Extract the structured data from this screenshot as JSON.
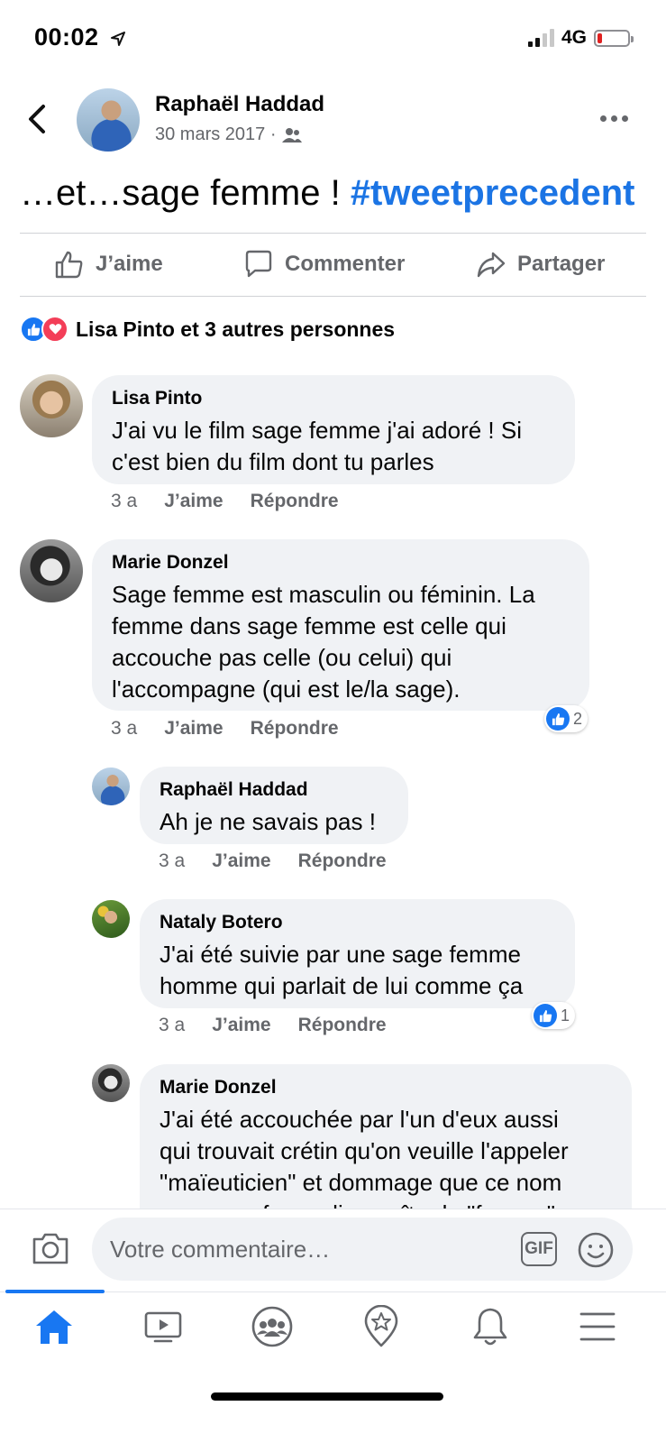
{
  "status_bar": {
    "time": "00:02",
    "network": "4G"
  },
  "post": {
    "author": "Raphaël Haddad",
    "date": "30 mars 2017 ·",
    "text": "…et…sage femme !",
    "hashtag": "#tweetprecedent"
  },
  "actions": {
    "like": "J’aime",
    "comment": "Commenter",
    "share": "Partager"
  },
  "reactions": {
    "summary": "Lisa Pinto et 3 autres personnes"
  },
  "comments": [
    {
      "name": "Lisa Pinto",
      "text_lines": [
        "J'ai vu le film sage femme j'ai adoré ! Si",
        "c'est bien du film dont tu parles"
      ],
      "age": "3 a",
      "like": "J’aime",
      "reply": "Répondre"
    },
    {
      "name": "Marie Donzel",
      "text_lines": [
        "Sage femme est masculin ou féminin. La",
        "femme dans sage femme est celle qui",
        "accouche pas celle (ou celui) qui",
        "l'accompagne (qui est le/la sage)."
      ],
      "age": "3 a",
      "like": "J’aime",
      "reply": "Répondre",
      "reaction_count": "2"
    },
    {
      "name": "Raphaël Haddad",
      "text_lines": [
        "Ah je ne savais pas !"
      ],
      "age": "3 a",
      "like": "J’aime",
      "reply": "Répondre"
    },
    {
      "name": "Nataly Botero",
      "text_lines": [
        "J'ai été suivie par une sage femme",
        "homme qui parlait de lui comme ça"
      ],
      "age": "3 a",
      "like": "J’aime",
      "reply": "Répondre",
      "reaction_count": "1"
    },
    {
      "name": "Marie Donzel",
      "text_lines": [
        "J'ai été accouchée par l'un d'eux aussi",
        "qui trouvait crétin qu'on veuille l'appeler",
        "\"maïeuticien\" et dommage que ce nom",
        "pompeux fasse disparaître le \"femme\""
      ]
    }
  ],
  "composer": {
    "placeholder": "Votre commentaire…",
    "gif": "GIF"
  },
  "nav": [
    "home-icon",
    "video-icon",
    "groups-icon",
    "pages-icon",
    "bell-icon",
    "menu-icon"
  ],
  "colors": {
    "accent": "#1877f2",
    "hashtag": "#1b74e4",
    "bubble": "#f0f2f5",
    "secondary_text": "#65676b"
  }
}
